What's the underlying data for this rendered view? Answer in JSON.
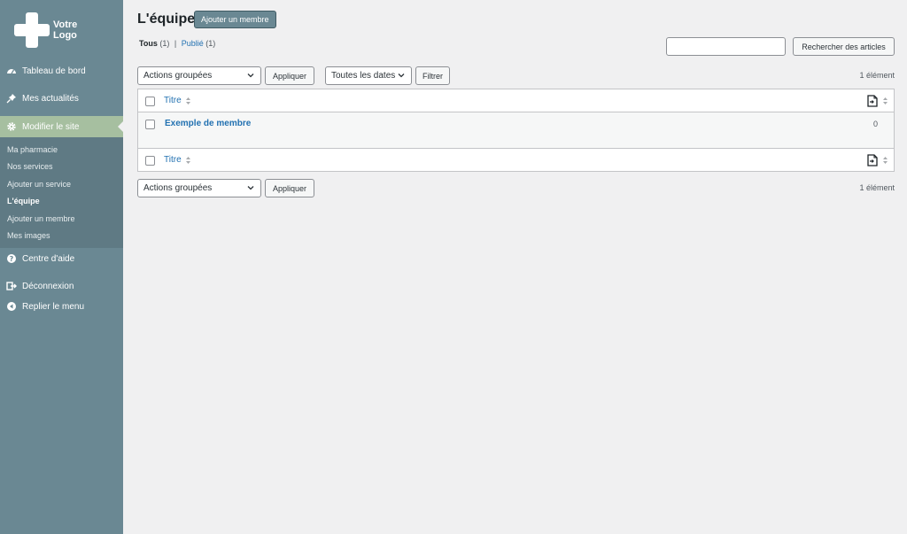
{
  "logo": {
    "line1": "Votre",
    "line2": "Logo"
  },
  "sidebar": {
    "items": [
      {
        "label": "Tableau de bord",
        "icon": "dashboard-icon"
      },
      {
        "label": "Mes actualités",
        "icon": "pin-icon"
      },
      {
        "label": "Modifier le site",
        "icon": "gear-icon"
      },
      {
        "label": "Centre d'aide",
        "icon": "help-icon"
      },
      {
        "label": "Déconnexion",
        "icon": "logout-icon"
      },
      {
        "label": "Replier le menu",
        "icon": "collapse-icon"
      }
    ],
    "submenu": [
      "Ma pharmacie",
      "Nos services",
      "Ajouter un service",
      "L'équipe",
      "Ajouter un membre",
      "Mes images"
    ]
  },
  "header": {
    "title": "L'équipe",
    "add_button": "Ajouter un membre"
  },
  "filters_status": {
    "all_label": "Tous",
    "all_count": "(1)",
    "separator": "|",
    "published_label": "Publié",
    "published_count": "(1)"
  },
  "search": {
    "placeholder": "",
    "button": "Rechercher des articles"
  },
  "tablenav_top": {
    "bulk_actions": "Actions groupées",
    "apply": "Appliquer",
    "dates": "Toutes les dates",
    "filter": "Filtrer",
    "count": "1 élément"
  },
  "table": {
    "column_title": "Titre",
    "rows": [
      {
        "title": "Exemple de membre",
        "count": "0"
      }
    ]
  },
  "tablenav_bottom": {
    "bulk_actions": "Actions groupées",
    "apply": "Appliquer",
    "count": "1 élément"
  }
}
